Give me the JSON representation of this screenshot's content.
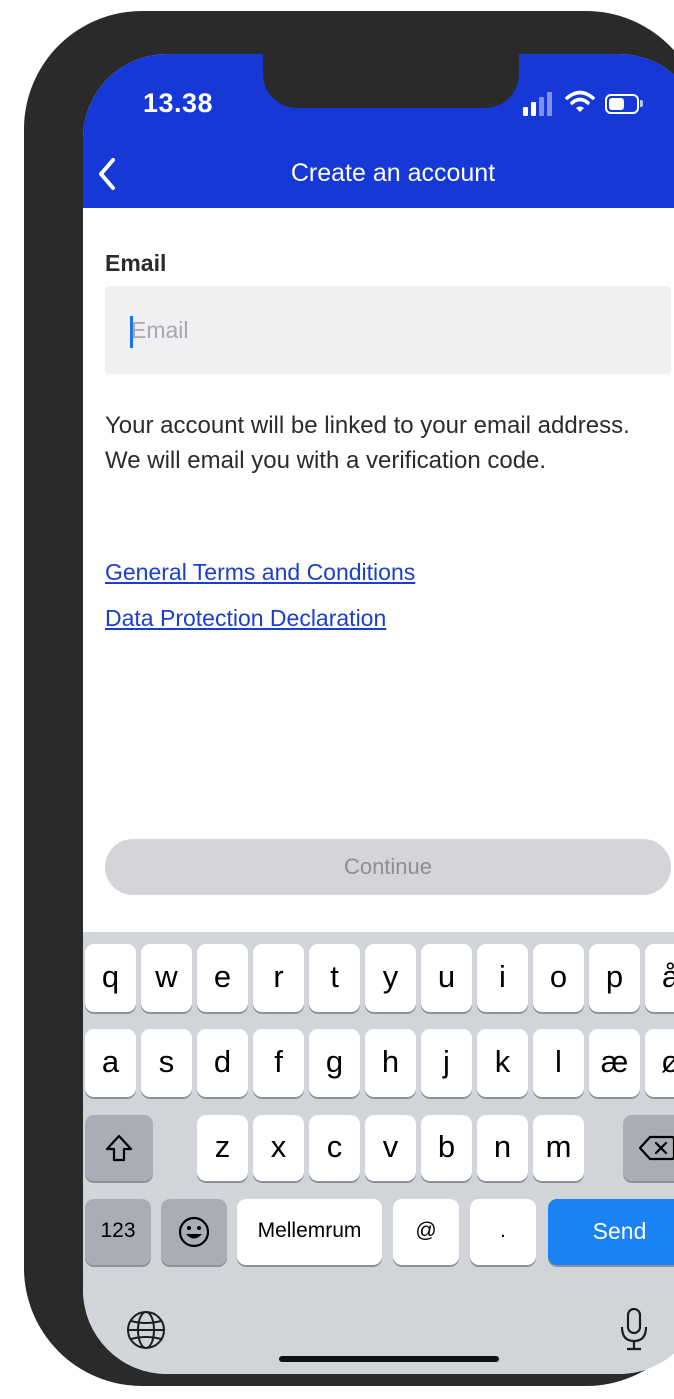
{
  "status_bar": {
    "time": "13.38",
    "icons": [
      "signal-icon",
      "wifi-icon",
      "battery-icon"
    ]
  },
  "nav": {
    "title": "Create an account",
    "back_icon": "chevron-left-icon"
  },
  "form": {
    "email_label": "Email",
    "email_placeholder": "Email",
    "email_value": ""
  },
  "info_text": "Your account will be linked to your email address. We will email you with a verification code.",
  "links": {
    "terms": "General Terms and Conditions",
    "privacy": "Data Protection Declaration"
  },
  "continue_label": "Continue",
  "keyboard": {
    "row1": [
      "q",
      "w",
      "e",
      "r",
      "t",
      "y",
      "u",
      "i",
      "o",
      "p",
      "å"
    ],
    "row2": [
      "a",
      "s",
      "d",
      "f",
      "g",
      "h",
      "j",
      "k",
      "l",
      "æ",
      "ø"
    ],
    "row3": [
      "z",
      "x",
      "c",
      "v",
      "b",
      "n",
      "m"
    ],
    "numbers_label": "123",
    "space_label": "Mellemrum",
    "at_label": "@",
    "period_label": ".",
    "send_label": "Send"
  },
  "colors": {
    "header": "#1538d6",
    "link": "#1a3ecf",
    "send": "#1a82f4",
    "continue_disabled": "#d3d5d8"
  }
}
